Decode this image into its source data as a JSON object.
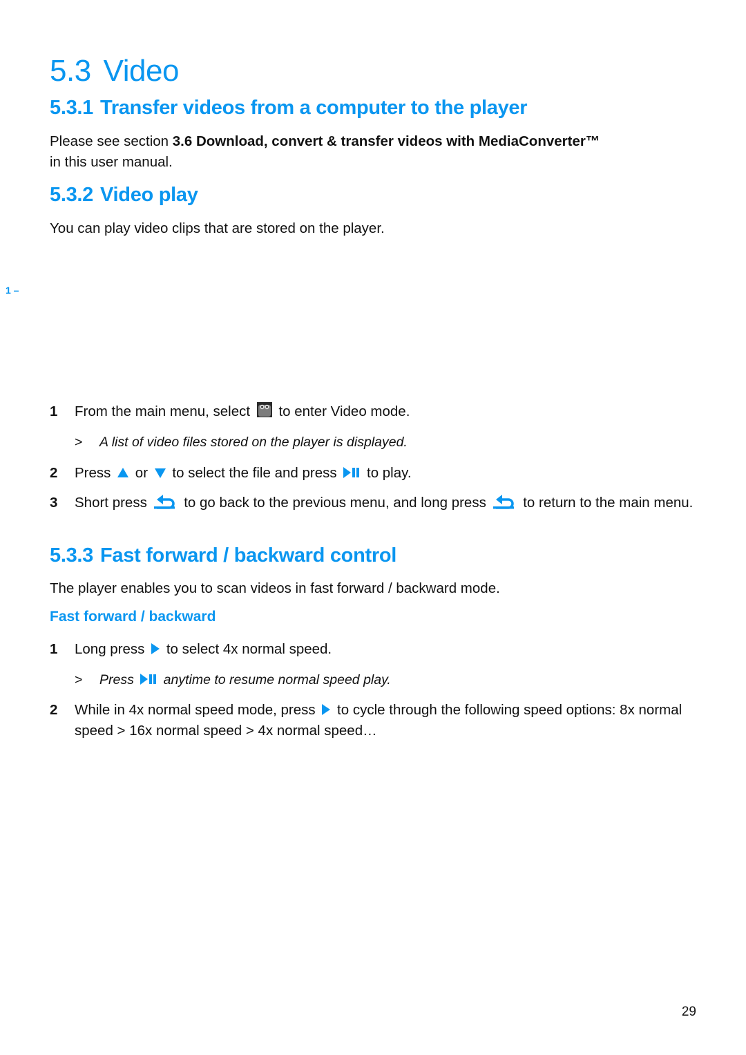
{
  "page": {
    "number": "29"
  },
  "section": {
    "number": "5.3",
    "title": "Video"
  },
  "s531": {
    "number": "5.3.1",
    "title": "Transfer videos from a computer to the player",
    "text_prefix": "Please see section ",
    "text_bold": "3.6 Download, convert & transfer videos with MediaConverter™",
    "text_suffix": "in this user manual."
  },
  "s532": {
    "number": "5.3.2",
    "title": "Video play",
    "intro": "You can play video clips that are stored on the player.",
    "figure_marker": "1 –",
    "steps": [
      {
        "n": "1",
        "a": "From the main menu, select ",
        "icon": "video-icon",
        "b": " to enter Video mode.",
        "result": "A list of video files stored on the player is displayed."
      },
      {
        "n": "2",
        "a": "Press ",
        "icon1": "up-arrow-icon",
        "b": " or ",
        "icon2": "down-arrow-icon",
        "c": " to select the file and press ",
        "icon3": "play-pause-icon",
        "d": " to play."
      },
      {
        "n": "3",
        "a": "Short press ",
        "icon1": "back-icon",
        "b": " to go back to the previous menu, and long press ",
        "icon2": "back-icon",
        "c": " to return to the main menu."
      }
    ]
  },
  "s533": {
    "number": "5.3.3",
    "title": "Fast forward / backward control",
    "intro": "The player enables you to scan videos in fast forward / backward mode.",
    "subheading": "Fast forward / backward",
    "steps": [
      {
        "n": "1",
        "a": "Long press ",
        "icon": "right-arrow-icon",
        "b": " to select 4x normal speed.",
        "result_a": "Press ",
        "result_icon": "play-pause-icon",
        "result_b": " anytime to resume normal speed play."
      },
      {
        "n": "2",
        "a": "While in 4x normal speed mode, press ",
        "icon": "right-arrow-icon",
        "b": " to cycle through the following speed options: 8x normal speed > 16x normal speed > 4x normal speed…"
      }
    ]
  },
  "result_marker": ">",
  "colors": {
    "accent": "#0a96f0",
    "text": "#111111"
  }
}
